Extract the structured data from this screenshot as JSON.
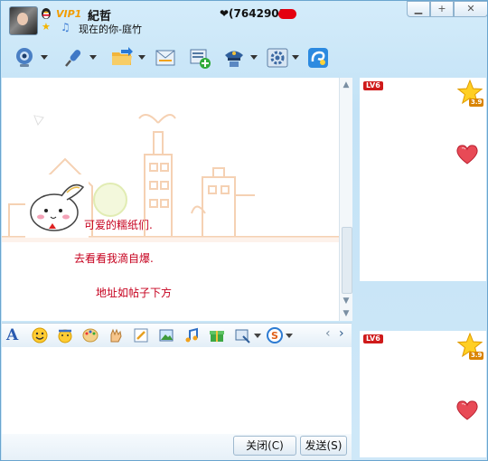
{
  "title_bar": {
    "vip_badge": "VIP1",
    "nickname": "紀哲",
    "qq_number": "❤(7642903",
    "status_message": "现在的你-庭竹"
  },
  "window_controls": {
    "minimize": "▁",
    "maximize": "+",
    "close": "✕"
  },
  "toolbar": {
    "buttons": [
      {
        "name": "video-call",
        "icon": "webcam-icon"
      },
      {
        "name": "voice-call",
        "icon": "microphone-icon"
      },
      {
        "name": "send-file",
        "icon": "folder-icon"
      },
      {
        "name": "send-message",
        "icon": "mail-icon"
      },
      {
        "name": "app",
        "icon": "app-plus-icon"
      },
      {
        "name": "remote",
        "icon": "police-hat-icon"
      },
      {
        "name": "settings",
        "icon": "gear-icon"
      },
      {
        "name": "more",
        "icon": "swirl-icon"
      }
    ]
  },
  "chat": {
    "messages": [
      "可爱的糯纸们.",
      "去看看我滴自爆.",
      "地址如帖子下方"
    ]
  },
  "format_bar": {
    "font_letter": "A"
  },
  "buttons": {
    "close": "关闭(C)",
    "send": "发送(S)"
  },
  "side_panel": {
    "level_badge": "LV6",
    "level_number": "3.9"
  }
}
